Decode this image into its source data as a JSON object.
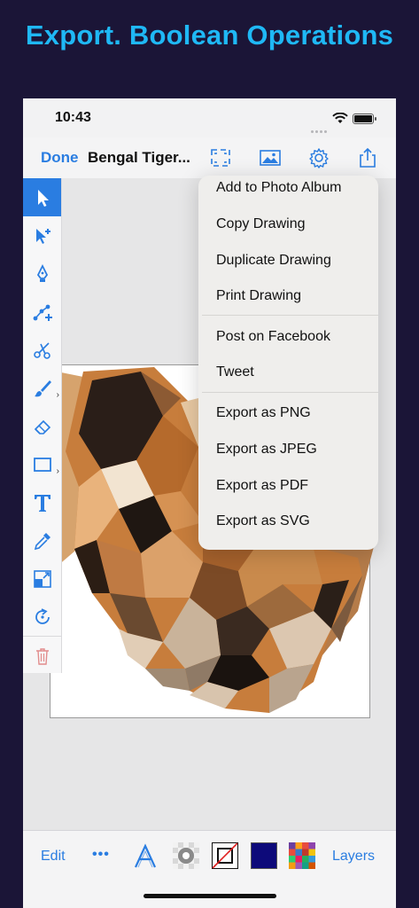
{
  "promo": {
    "title": "Export. Boolean Operations"
  },
  "status": {
    "time": "10:43"
  },
  "navbar": {
    "done": "Done",
    "title": "Bengal Tiger..."
  },
  "toolbar": {
    "tools": [
      "select",
      "direct-select",
      "pen",
      "add-anchor",
      "scissors",
      "brush",
      "eraser",
      "rectangle",
      "text",
      "eyedropper",
      "transform",
      "rotate",
      "trash"
    ]
  },
  "export_menu": {
    "items": [
      "Add to Photo Album",
      "Copy Drawing",
      "Duplicate Drawing",
      "Print Drawing",
      "Post on Facebook",
      "Tweet",
      "Export as PNG",
      "Export as JPEG",
      "Export as PDF",
      "Export as SVG"
    ]
  },
  "bottom": {
    "edit": "Edit",
    "more": "•••",
    "layers": "Layers",
    "fill_color": "#0d0a7a",
    "accent": "#2a7de1"
  }
}
